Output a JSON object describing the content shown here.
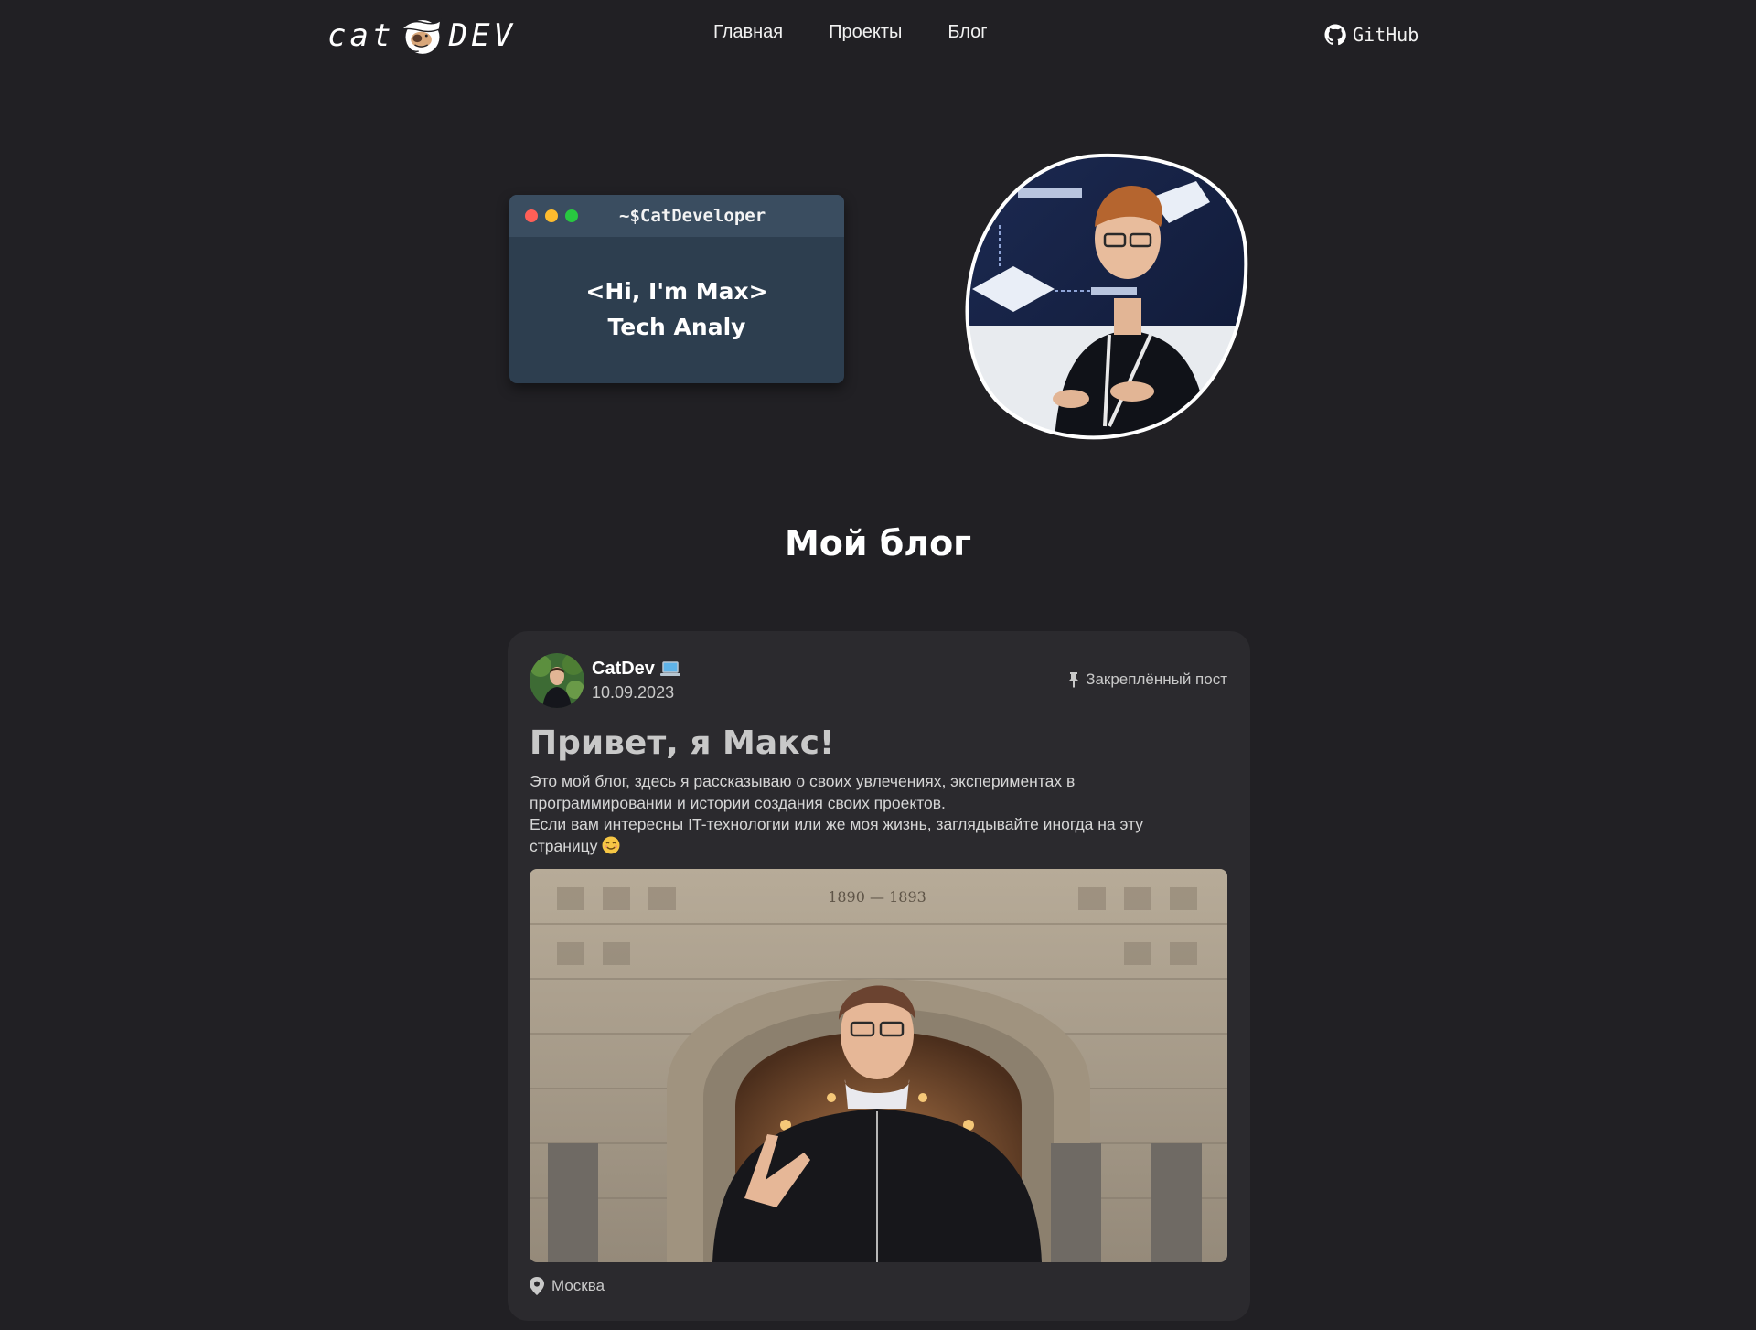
{
  "nav": {
    "logo_left": "cat",
    "logo_right": "dev",
    "links": [
      "Главная",
      "Проекты",
      "Блог"
    ],
    "github_label": "GitHub"
  },
  "hero": {
    "terminal_title": "~$CatDeveloper",
    "line1": "<Hi, I'm Max>",
    "line2": "Tech Analy"
  },
  "blog": {
    "heading": "Мой блог",
    "post": {
      "author": "CatDev",
      "date": "10.09.2023",
      "pinned_label": "Закреплённый пост",
      "title": "Привет, я Макс!",
      "paragraph1": "Это мой блог, здесь я рассказываю о своих увлечениях, экспериментах в программировании и истории создания своих проектов.",
      "paragraph2": "Если вам интересны IT-технологии или же моя жизнь, заглядывайте иногда на эту страницу",
      "location": "Москва"
    }
  },
  "icons": {
    "github": "github-icon",
    "laptop": "laptop-icon",
    "pin": "pin-icon",
    "location": "map-pin-icon",
    "emoji": "smiling-face-icon"
  },
  "colors": {
    "background": "#212024",
    "card": "#2b2a2e",
    "terminal": "#2d3e4f",
    "terminal_bar": "#3a4d60"
  }
}
